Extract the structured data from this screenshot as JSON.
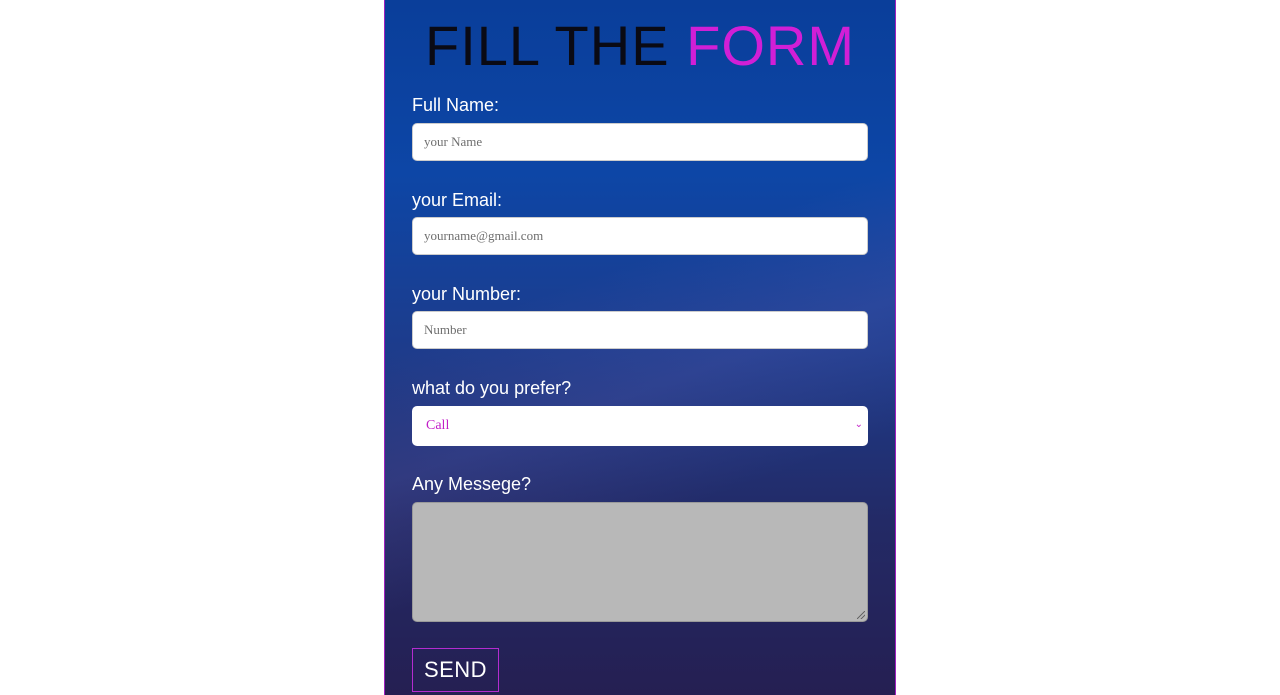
{
  "form": {
    "title_part1": "FILL THE",
    "title_part2": "FORM",
    "accent_color": "#d11fd6",
    "name": {
      "label": "Full Name:",
      "placeholder": "your Name",
      "value": ""
    },
    "email": {
      "label": "your Email:",
      "placeholder": "yourname@gmail.com",
      "value": ""
    },
    "number": {
      "label": "your Number:",
      "placeholder": "Number",
      "value": ""
    },
    "preference": {
      "label": "what do you prefer?",
      "selected": "Call",
      "chevron_icon": "chevron-down-icon"
    },
    "message": {
      "label": "Any Messege?",
      "value": ""
    },
    "send_label": "SEND"
  }
}
